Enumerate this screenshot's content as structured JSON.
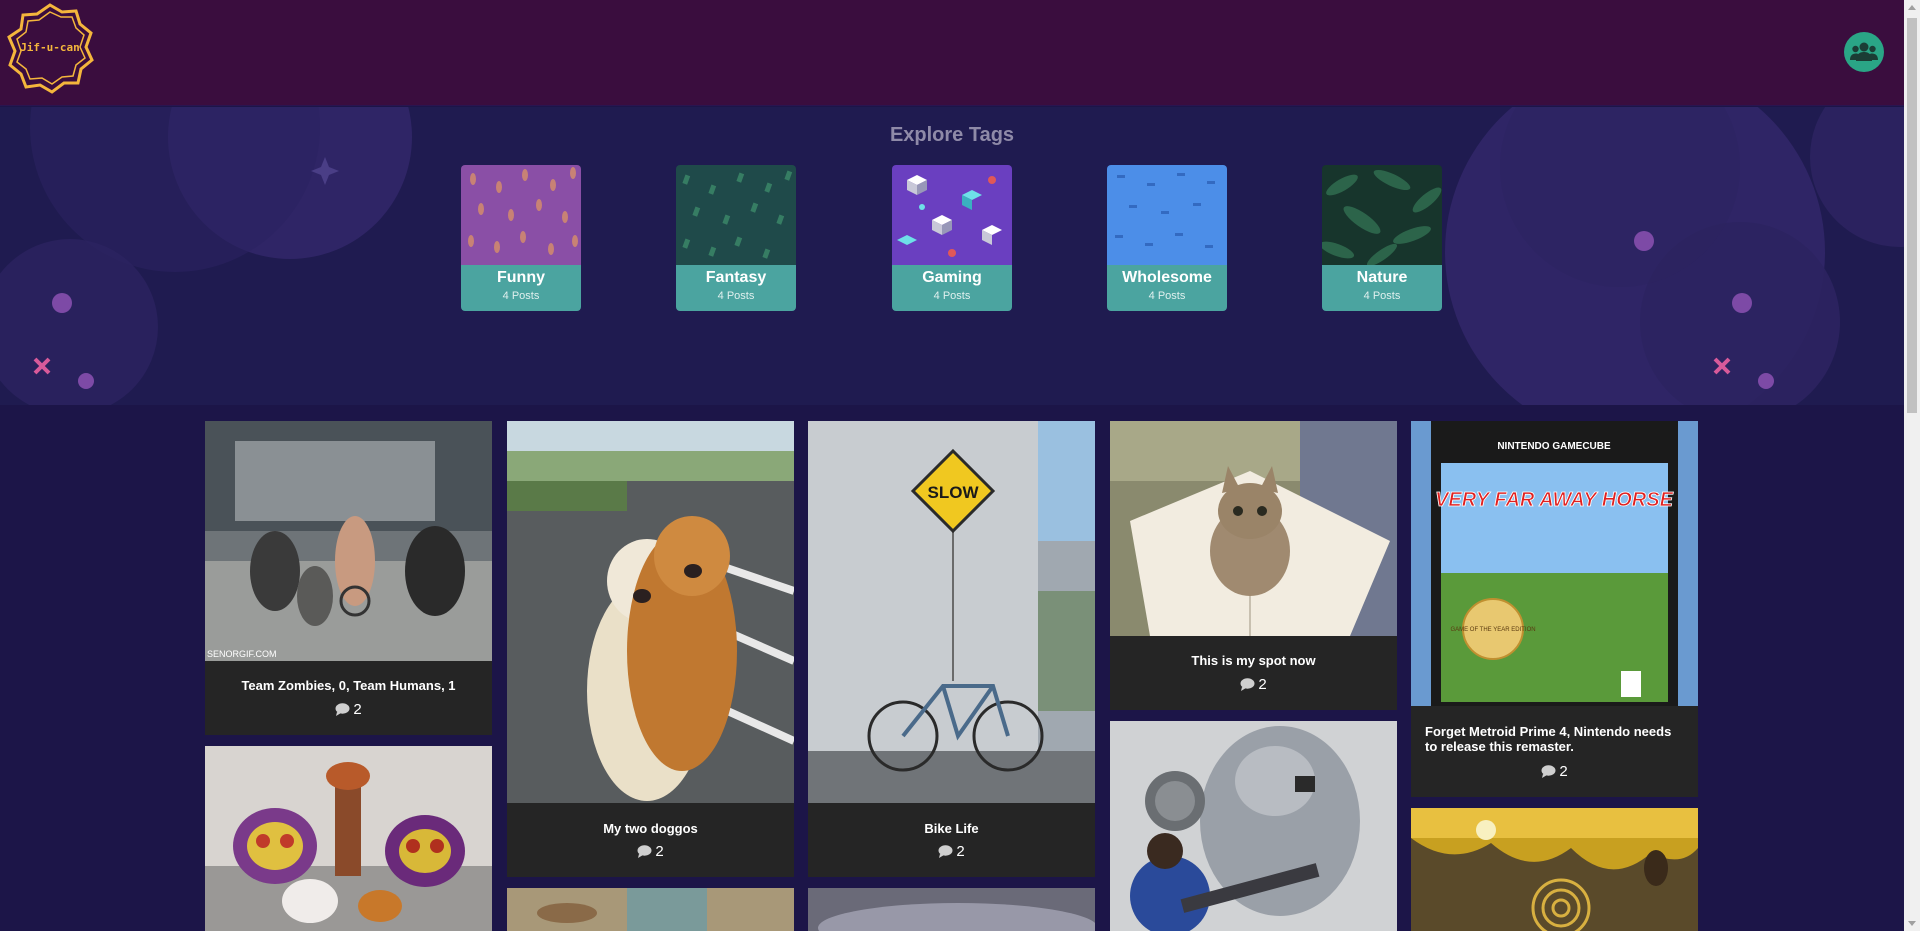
{
  "app": {
    "logo_text": "Jif-u-can"
  },
  "header": {
    "profile_icon": "users-icon"
  },
  "hero": {
    "title": "Explore Tags"
  },
  "tags": [
    {
      "name": "Funny",
      "count": "4 Posts",
      "color": "#8a4fa6"
    },
    {
      "name": "Fantasy",
      "count": "4 Posts",
      "color": "#1f4a4a"
    },
    {
      "name": "Gaming",
      "count": "4 Posts",
      "color": "#6a3fc0"
    },
    {
      "name": "Wholesome",
      "count": "4 Posts",
      "color": "#4c8ee8"
    },
    {
      "name": "Nature",
      "count": "4 Posts",
      "color": "#17352c"
    }
  ],
  "posts": [
    {
      "title": "Team Zombies, 0, Team Humans, 1",
      "comments": "2",
      "watermark": "SENORGIF.COM"
    },
    {
      "title": "My two doggos",
      "comments": "2"
    },
    {
      "title": "Bike Life",
      "comments": "2",
      "sign": "SLOW"
    },
    {
      "title": "This is my spot now",
      "comments": "2"
    },
    {
      "title": "Forget Metroid Prime 4, Nintendo needs to release this remaster.",
      "comments": "2",
      "box_brand": "NINTENDO GAMECUBE",
      "box_title": "VERY FAR AWAY HORSE",
      "box_badge": "GAME OF THE YEAR EDITION"
    },
    {
      "title": "",
      "comments": ""
    },
    {
      "title": "",
      "comments": ""
    },
    {
      "title": "",
      "comments": ""
    },
    {
      "title": "",
      "comments": ""
    },
    {
      "title": "",
      "comments": ""
    }
  ],
  "colors": {
    "header_bg": "#3a0d3e",
    "page_bg": "#1c1548",
    "tag_label_bg": "#4ba4a0",
    "logo_accent": "#f4b63c",
    "profile_bg": "#2aa586"
  }
}
